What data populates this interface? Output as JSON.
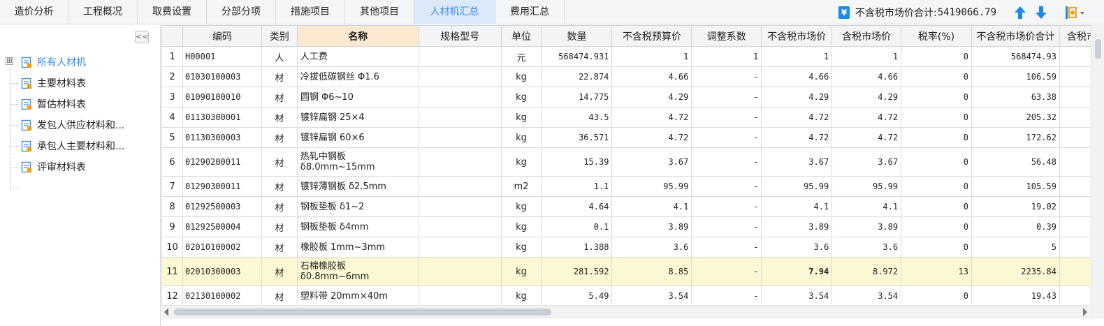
{
  "tabs": [
    {
      "label": "造价分析",
      "active": false
    },
    {
      "label": "工程概况",
      "active": false
    },
    {
      "label": "取费设置",
      "active": false
    },
    {
      "label": "分部分项",
      "active": false
    },
    {
      "label": "措施项目",
      "active": false
    },
    {
      "label": "其他项目",
      "active": false
    },
    {
      "label": "人材机汇总",
      "active": true
    },
    {
      "label": "费用汇总",
      "active": false
    }
  ],
  "summary": {
    "label": "不含税市场价合计:",
    "value": "5419066.79",
    "icon": "yen-icon"
  },
  "toolbar": {
    "up_icon": "arrow-up-icon",
    "down_icon": "arrow-down-icon",
    "settings_icon": "settings-dropdown-icon",
    "collapse_label": "<<"
  },
  "tree": {
    "expander": "⊞",
    "items": [
      {
        "label": "所有人材机",
        "selected": true
      },
      {
        "label": "主要材料表",
        "selected": false
      },
      {
        "label": "暂估材料表",
        "selected": false
      },
      {
        "label": "发包人供应材料和...",
        "selected": false
      },
      {
        "label": "承包人主要材料和...",
        "selected": false
      },
      {
        "label": "评审材料表",
        "selected": false
      }
    ]
  },
  "grid": {
    "columns": [
      "",
      "编码",
      "类别",
      "名称",
      "规格型号",
      "单位",
      "数量",
      "不含税预算价",
      "调整系数",
      "不含税市场价",
      "含税市场价",
      "税率(%)",
      "不含税市场价合计",
      "含税市"
    ],
    "sorted_column": "名称",
    "rows": [
      {
        "n": "1",
        "code": "H00001",
        "type": "人",
        "name": "人工费",
        "spec": "",
        "unit": "元",
        "qty": "568474.931",
        "budget": "1",
        "coef": "1",
        "market": "1",
        "taxmarket": "1",
        "rate": "0",
        "total": "568474.93",
        "extra": "",
        "highlight": false
      },
      {
        "n": "2",
        "code": "01030100003",
        "type": "材",
        "name": "冷拔低碳钢丝 Φ1.6",
        "spec": "",
        "unit": "kg",
        "qty": "22.874",
        "budget": "4.66",
        "coef": "-",
        "market": "4.66",
        "taxmarket": "4.66",
        "rate": "0",
        "total": "106.59",
        "extra": "",
        "highlight": false
      },
      {
        "n": "3",
        "code": "01090100010",
        "type": "材",
        "name": "圆钢 Φ6~10",
        "spec": "",
        "unit": "kg",
        "qty": "14.775",
        "budget": "4.29",
        "coef": "-",
        "market": "4.29",
        "taxmarket": "4.29",
        "rate": "0",
        "total": "63.38",
        "extra": "",
        "highlight": false
      },
      {
        "n": "4",
        "code": "01130300001",
        "type": "材",
        "name": "镀锌扁钢 25×4",
        "spec": "",
        "unit": "kg",
        "qty": "43.5",
        "budget": "4.72",
        "coef": "-",
        "market": "4.72",
        "taxmarket": "4.72",
        "rate": "0",
        "total": "205.32",
        "extra": "",
        "highlight": false
      },
      {
        "n": "5",
        "code": "01130300003",
        "type": "材",
        "name": "镀锌扁钢 60×6",
        "spec": "",
        "unit": "kg",
        "qty": "36.571",
        "budget": "4.72",
        "coef": "-",
        "market": "4.72",
        "taxmarket": "4.72",
        "rate": "0",
        "total": "172.62",
        "extra": "",
        "highlight": false
      },
      {
        "n": "6",
        "code": "01290200011",
        "type": "材",
        "name": "热轧中钢板 δ8.0mm~15mm",
        "spec": "",
        "unit": "kg",
        "qty": "15.39",
        "budget": "3.67",
        "coef": "-",
        "market": "3.67",
        "taxmarket": "3.67",
        "rate": "0",
        "total": "56.48",
        "extra": "",
        "highlight": false,
        "tall": true
      },
      {
        "n": "7",
        "code": "01290300011",
        "type": "材",
        "name": "镀锌薄钢板 δ2.5mm",
        "spec": "",
        "unit": "m2",
        "qty": "1.1",
        "budget": "95.99",
        "coef": "-",
        "market": "95.99",
        "taxmarket": "95.99",
        "rate": "0",
        "total": "105.59",
        "extra": "",
        "highlight": false
      },
      {
        "n": "8",
        "code": "01292500003",
        "type": "材",
        "name": "钢板垫板 δ1~2",
        "spec": "",
        "unit": "kg",
        "qty": "4.64",
        "budget": "4.1",
        "coef": "-",
        "market": "4.1",
        "taxmarket": "4.1",
        "rate": "0",
        "total": "19.02",
        "extra": "",
        "highlight": false
      },
      {
        "n": "9",
        "code": "01292500004",
        "type": "材",
        "name": "钢板垫板 δ4mm",
        "spec": "",
        "unit": "kg",
        "qty": "0.1",
        "budget": "3.89",
        "coef": "-",
        "market": "3.89",
        "taxmarket": "3.89",
        "rate": "0",
        "total": "0.39",
        "extra": "",
        "highlight": false
      },
      {
        "n": "10",
        "code": "02010100002",
        "type": "材",
        "name": "橡胶板 1mm~3mm",
        "spec": "",
        "unit": "kg",
        "qty": "1.388",
        "budget": "3.6",
        "coef": "-",
        "market": "3.6",
        "taxmarket": "3.6",
        "rate": "0",
        "total": "5",
        "extra": "",
        "highlight": false
      },
      {
        "n": "11",
        "code": "02010300003",
        "type": "材",
        "name": "石棉橡胶板 δ0.8mm~6mm",
        "spec": "",
        "unit": "kg",
        "qty": "281.592",
        "budget": "8.85",
        "coef": "-",
        "market": "7.94",
        "taxmarket": "8.972",
        "rate": "13",
        "total": "2235.84",
        "extra": "",
        "highlight": true,
        "tall": true
      },
      {
        "n": "12",
        "code": "02130100002",
        "type": "材",
        "name": "塑料带 20mm×40m",
        "spec": "",
        "unit": "kg",
        "qty": "5.49",
        "budget": "3.54",
        "coef": "-",
        "market": "3.54",
        "taxmarket": "3.54",
        "rate": "0",
        "total": "19.43",
        "extra": "",
        "highlight": false
      }
    ]
  },
  "colors": {
    "accent": "#3b8beb",
    "active_tab_bg": "#dbe9fb",
    "highlight_row": "#fdf8d4",
    "sorted_header": "#fde9cf"
  }
}
